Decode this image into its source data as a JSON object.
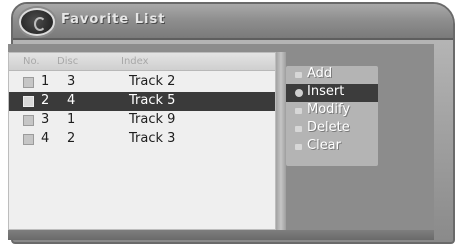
{
  "window": {
    "title": "Favorite List"
  },
  "list": {
    "headers": {
      "no": "No.",
      "disc": "Disc",
      "index": "Index"
    },
    "rows": [
      {
        "no": "1",
        "disc": "3",
        "track": "Track  2",
        "selected": false
      },
      {
        "no": "2",
        "disc": "4",
        "track": "Track  5",
        "selected": true
      },
      {
        "no": "3",
        "disc": "1",
        "track": "Track  9",
        "selected": false
      },
      {
        "no": "4",
        "disc": "2",
        "track": "Track  3",
        "selected": false
      }
    ]
  },
  "menu": {
    "items": [
      {
        "label": "Add",
        "selected": false
      },
      {
        "label": "Insert",
        "selected": true
      },
      {
        "label": "Modify",
        "selected": false
      },
      {
        "label": "Delete",
        "selected": false
      },
      {
        "label": "Clear",
        "selected": false
      }
    ]
  },
  "colors": {
    "selection": "#3a3a3a",
    "panel_background": "#8c8c8c",
    "list_background": "#efefef"
  }
}
